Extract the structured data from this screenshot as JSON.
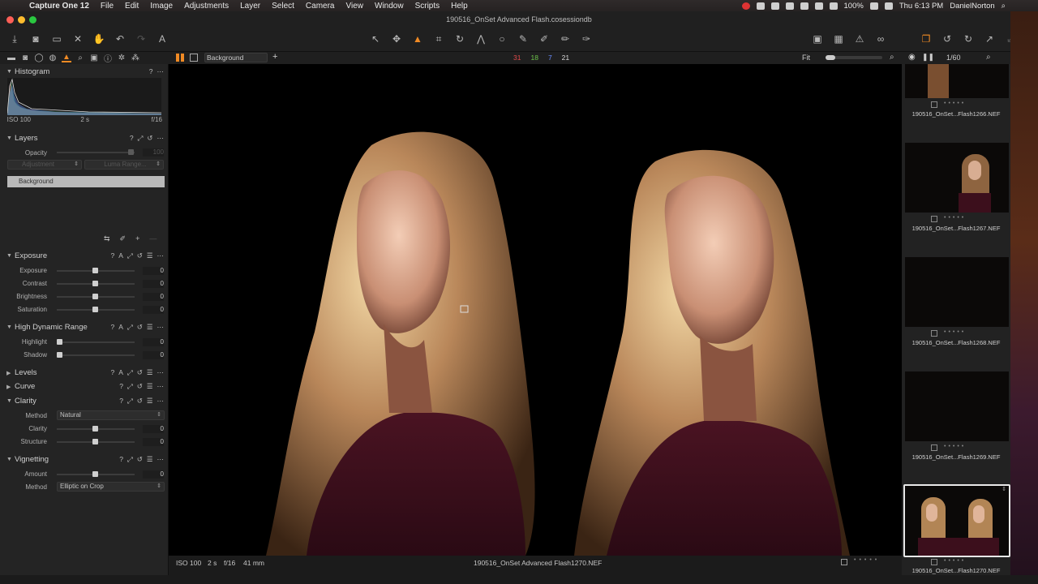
{
  "menubar": {
    "app": "Capture One 12",
    "items": [
      "File",
      "Edit",
      "Image",
      "Adjustments",
      "Layer",
      "Select",
      "Camera",
      "View",
      "Window",
      "Scripts",
      "Help"
    ],
    "battery": "100%",
    "clock": "Thu 6:13 PM",
    "user": "DanielNorton"
  },
  "window": {
    "title": "190516_OnSet Advanced Flash.cosessiondb"
  },
  "viewer_toolbar": {
    "variant": "Background",
    "counts": [
      {
        "value": "31",
        "color": "#e04a4a"
      },
      {
        "value": "18",
        "color": "#6cc24a"
      },
      {
        "value": "7",
        "color": "#6a8cff"
      },
      {
        "value": "21",
        "color": "#d8d8d8"
      }
    ],
    "zoom_label": "Fit"
  },
  "browser_bar": {
    "count": "1/60"
  },
  "histogram": {
    "title": "Histogram",
    "iso": "ISO 100",
    "shutter": "2 s",
    "aperture": "f/16"
  },
  "layers": {
    "title": "Layers",
    "opacity_label": "Opacity",
    "opacity_value": "100",
    "adjustment_label": "Adjustment",
    "luma_label": "Luma Range...",
    "layer_name": "Background"
  },
  "exposure": {
    "title": "Exposure",
    "rows": [
      {
        "label": "Exposure",
        "value": "0"
      },
      {
        "label": "Contrast",
        "value": "0"
      },
      {
        "label": "Brightness",
        "value": "0"
      },
      {
        "label": "Saturation",
        "value": "0"
      }
    ]
  },
  "hdr": {
    "title": "High Dynamic Range",
    "rows": [
      {
        "label": "Highlight",
        "value": "0"
      },
      {
        "label": "Shadow",
        "value": "0"
      }
    ]
  },
  "levels": {
    "title": "Levels"
  },
  "curve": {
    "title": "Curve"
  },
  "clarity": {
    "title": "Clarity",
    "method_label": "Method",
    "method_value": "Natural",
    "rows": [
      {
        "label": "Clarity",
        "value": "0"
      },
      {
        "label": "Structure",
        "value": "0"
      }
    ]
  },
  "vignetting": {
    "title": "Vignetting",
    "amount_label": "Amount",
    "amount_value": "0",
    "method_label": "Method",
    "method_value": "Elliptic on Crop"
  },
  "viewer_status": {
    "iso": "ISO 100",
    "shutter": "2 s",
    "aperture": "f/16",
    "focal": "41 mm",
    "filename": "190516_OnSet Advanced Flash1270.NEF"
  },
  "thumbnails": [
    {
      "name": "190516_OnSet...Flash1266.NEF"
    },
    {
      "name": "190516_OnSet...Flash1267.NEF"
    },
    {
      "name": "190516_OnSet...Flash1268.NEF"
    },
    {
      "name": "190516_OnSet...Flash1269.NEF"
    },
    {
      "name": "190516_OnSet...Flash1270.NEF"
    }
  ]
}
